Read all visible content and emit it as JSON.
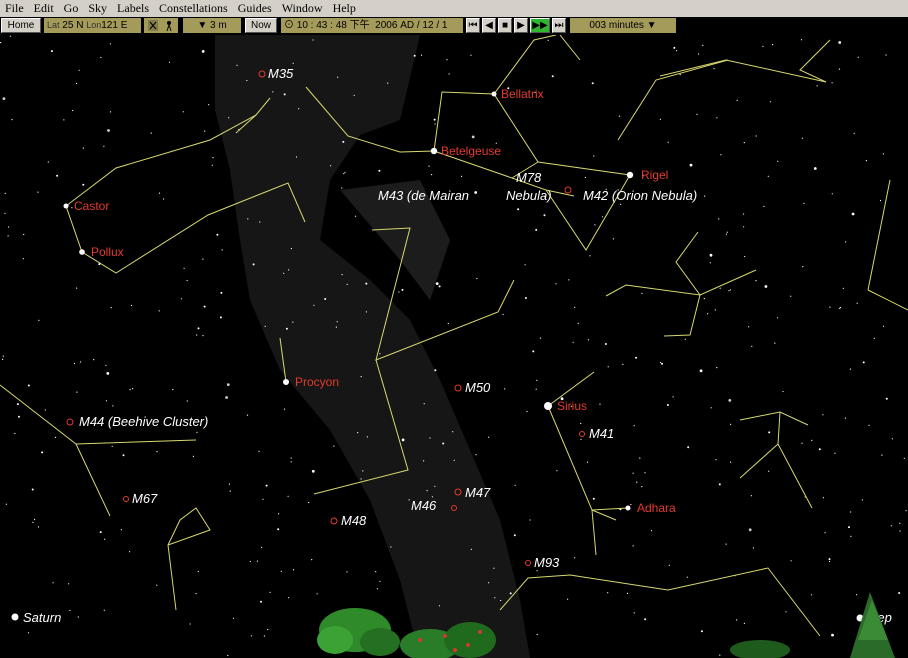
{
  "menu": [
    "File",
    "Edit",
    "Go",
    "Sky",
    "Labels",
    "Constellations",
    "Guides",
    "Window",
    "Help"
  ],
  "toolbar": {
    "home_label": "Home",
    "lat_label": "Lat",
    "lat_value": "25 N",
    "lon_label": "Lon",
    "lon_value": "121 E",
    "elevation": "3 m",
    "now_label": "Now",
    "time": "10 : 43 : 48 下午",
    "date": "2006 AD / 12 /   1",
    "step": "003 minutes"
  },
  "stars_named": [
    {
      "id": "betelgeuse",
      "name": "Betelgeuse"
    },
    {
      "id": "bellatrix",
      "name": "Bellatrix"
    },
    {
      "id": "rigel",
      "name": "Rigel"
    },
    {
      "id": "castor",
      "name": "Castor"
    },
    {
      "id": "pollux",
      "name": "Pollux"
    },
    {
      "id": "procyon",
      "name": "Procyon"
    },
    {
      "id": "sirius",
      "name": "Sirius"
    },
    {
      "id": "adhara",
      "name": "Adhara"
    }
  ],
  "objects": [
    {
      "id": "m35",
      "name": "M35"
    },
    {
      "id": "m78",
      "name": "M78"
    },
    {
      "id": "m43",
      "name": "M43 (de Mairan"
    },
    {
      "id": "m43b",
      "name": "Nebula)"
    },
    {
      "id": "m42",
      "name": "M42 (Orion Nebula)"
    },
    {
      "id": "m50",
      "name": "M50"
    },
    {
      "id": "m41",
      "name": "M41"
    },
    {
      "id": "m44",
      "name": "M44 (Beehive Cluster)"
    },
    {
      "id": "m67",
      "name": "M67"
    },
    {
      "id": "m47",
      "name": "M47"
    },
    {
      "id": "m46",
      "name": "M46"
    },
    {
      "id": "m48",
      "name": "M48"
    },
    {
      "id": "m93",
      "name": "M93"
    },
    {
      "id": "saturn",
      "name": "Saturn"
    },
    {
      "id": "regulus",
      "name": "Rep"
    }
  ],
  "colors": {
    "constellation_line": "#d8d870",
    "label_red": "#e23b2c",
    "milky_way": "#1a1a1a",
    "toolbar_olive": "#a49a5a"
  }
}
